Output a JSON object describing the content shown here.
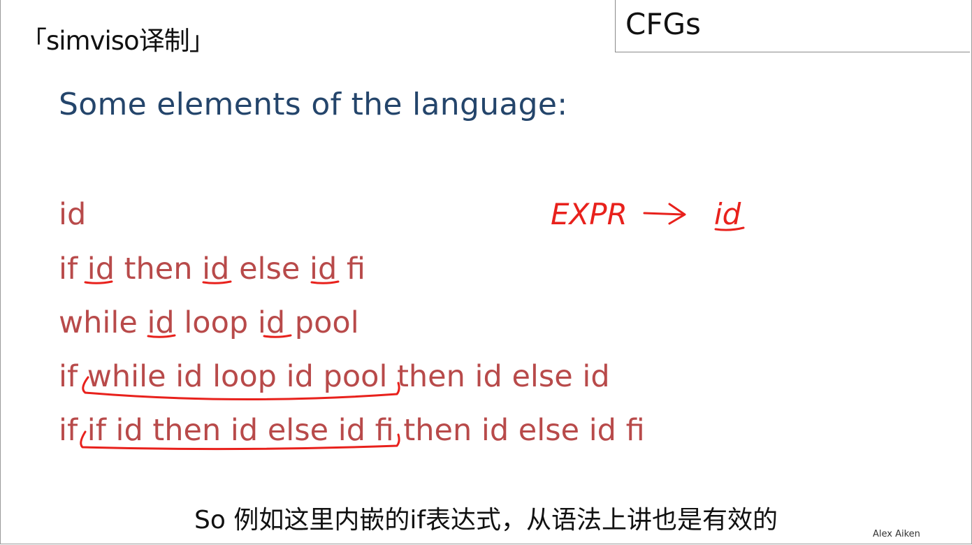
{
  "watermark": "「simviso译制」",
  "slide": {
    "title": "CFGs",
    "heading": "Some elements of the language:",
    "lines": [
      "id",
      "if id then id else id fi",
      "while id loop id pool",
      "if while id loop id pool then id else id",
      "if if id then id else id fi then id else id fi"
    ],
    "handwriting": {
      "rule_lhs": "EXPR",
      "rule_arrow": "→",
      "rule_rhs": "id",
      "ink_color": "#e8211c"
    },
    "author": "Alex Aiken"
  },
  "subtitle": "So 例如这里内嵌的if表达式，从语法上讲也是有效的",
  "colors": {
    "heading": "#24456b",
    "body_text": "#b84a4a",
    "ink": "#e8211c"
  }
}
